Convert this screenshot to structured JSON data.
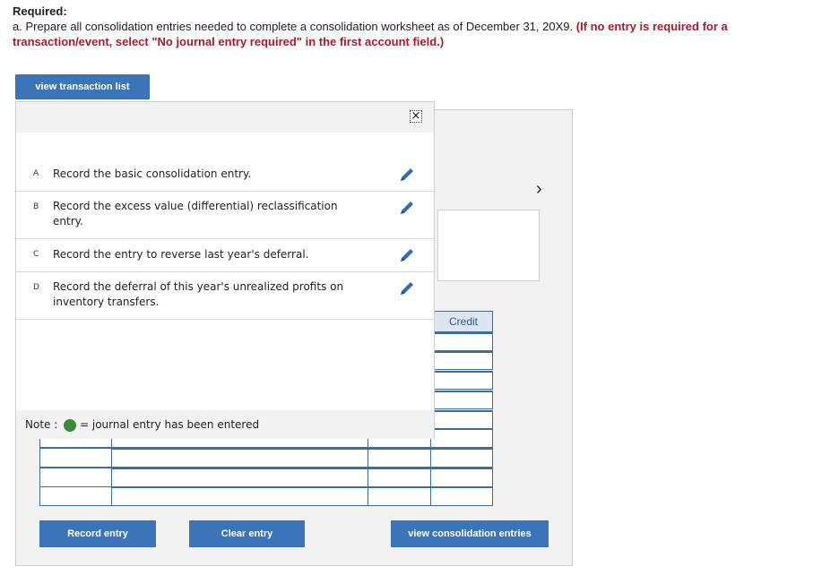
{
  "header": {
    "required_label": "Required:",
    "instruction": "a. Prepare all consolidation entries needed to complete a consolidation worksheet as of December 31, 20X9.",
    "instruction_note": "(If no entry is required for a transaction/event, select \"No journal entry required\" in the first account field.)"
  },
  "buttons": {
    "view_transaction_list": "view transaction list",
    "record_entry": "Record entry",
    "clear_entry": "Clear entry",
    "view_consolidation_entries": "view consolidation entries"
  },
  "popup": {
    "close_glyph": "×",
    "items": [
      {
        "letter": "A",
        "text": "Record the basic consolidation entry.",
        "icon": "pencil-icon"
      },
      {
        "letter": "B",
        "text": "Record the excess value (differential) reclassification entry.",
        "icon": "pencil-icon"
      },
      {
        "letter": "C",
        "text": "Record the entry to reverse last year's deferral.",
        "icon": "pencil-icon"
      },
      {
        "letter": "D",
        "text": "Record the deferral of this year's unrealized profits on inventory transfers.",
        "icon": "pencil-icon"
      }
    ],
    "note_label": "Note :",
    "note_text": "= journal entry has been entered"
  },
  "worksheet": {
    "credit_header": "Credit",
    "next_glyph": "›"
  },
  "colors": {
    "button_blue": "#3b74b8",
    "note_red": "#b0172a",
    "entered_green": "#3b8a3e",
    "grid_border": "#3e6d9c"
  }
}
